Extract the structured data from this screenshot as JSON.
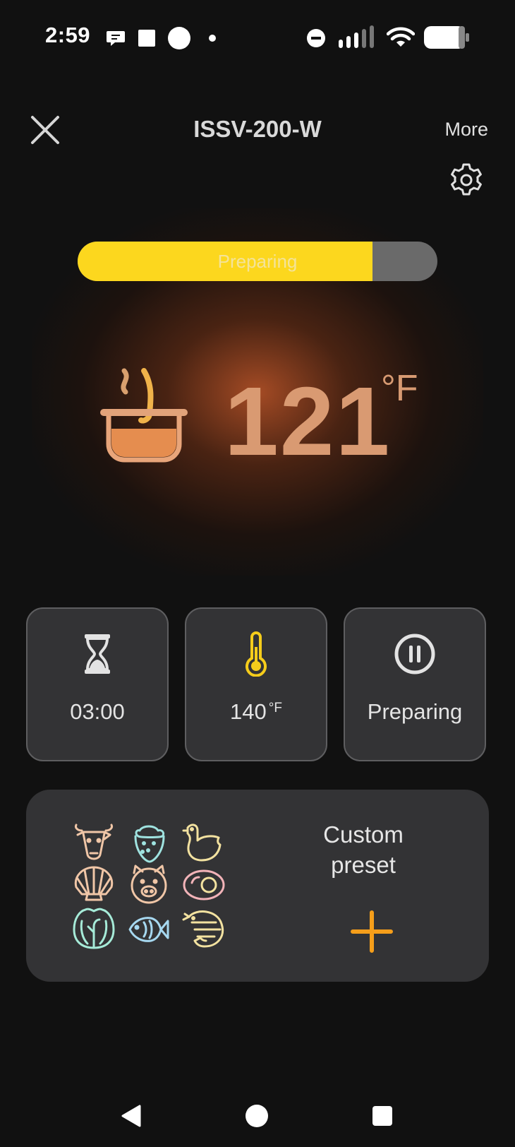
{
  "status_bar": {
    "time": "2:59",
    "icons": [
      "chat-bubble-icon",
      "square-notification-icon",
      "circle-notification-icon",
      "dot-icon",
      "do-not-disturb-icon",
      "signal-icon",
      "wifi-icon",
      "battery-icon"
    ]
  },
  "header": {
    "title": "ISSV-200-W",
    "more_label": "More",
    "close_icon": "close-icon",
    "settings_icon": "gear-icon"
  },
  "progress": {
    "label": "Preparing",
    "fraction": 0.82,
    "fill_color": "#fcd71e",
    "track_color": "#6a6a6a"
  },
  "temperature": {
    "value": "121",
    "unit": "°F",
    "color": "#d99a72",
    "icon": "pot-icon"
  },
  "cards": {
    "timer": {
      "icon": "hourglass-icon",
      "value": "03:00"
    },
    "target_temp": {
      "icon": "thermometer-icon",
      "value": "140",
      "unit": "°F",
      "icon_color": "#f5cc1b"
    },
    "status": {
      "icon": "pause-icon",
      "label": "Preparing"
    }
  },
  "preset": {
    "title_line1": "Custom",
    "title_line2": "preset",
    "plus_icon": "plus-icon",
    "plus_color": "#f59e1a",
    "food_icons": [
      "cow-icon",
      "strawberry-icon",
      "chicken-icon",
      "shell-icon",
      "pig-icon",
      "egg-icon",
      "lettuce-icon",
      "fish-icon",
      "shrimp-icon"
    ]
  },
  "nav_bar": {
    "back_icon": "back-triangle-icon",
    "home_icon": "home-circle-icon",
    "recents_icon": "recents-square-icon"
  }
}
